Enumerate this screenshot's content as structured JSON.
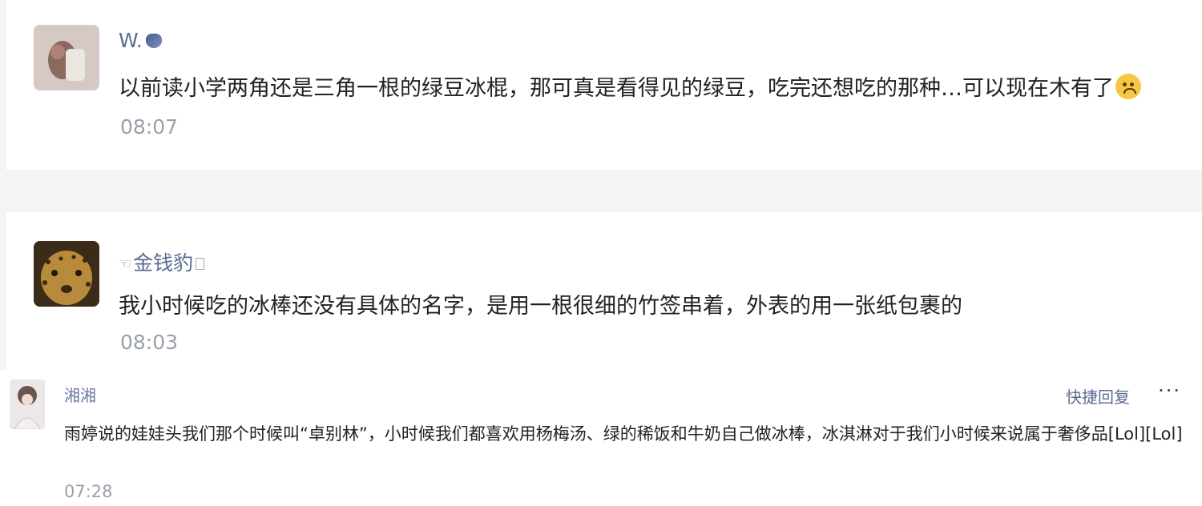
{
  "comments": [
    {
      "name": "W.",
      "text": "以前读小学两角还是三角一根的绿豆冰棍，那可真是看得见的绿豆，吃完还想吃的那种…可以现在木有了",
      "time": "08:07"
    },
    {
      "name": "金钱豹",
      "text": "我小时候吃的冰棒还没有具体的名字，是用一根很细的竹签串着，外表的用一张纸包裹的",
      "time": "08:03"
    },
    {
      "name": "湘湘",
      "text": "雨婷说的娃娃头我们那个时候叫“卓别林”，小时候我们都喜欢用杨梅汤、绿的稀饭和牛奶自己做冰棒，冰淇淋对于我们小时候来说属于奢侈品[Lol][Lol]",
      "time": "07:28",
      "quick_reply": "快捷回复",
      "more": "···"
    }
  ],
  "colors": {
    "name": "#5b6b92",
    "text": "#222222",
    "time": "#9aa0a8",
    "background": "#f3f4f6"
  },
  "icons": [
    "avatar-photo",
    "crying-emoji",
    "pointing-hand-icon",
    "more-icon"
  ]
}
